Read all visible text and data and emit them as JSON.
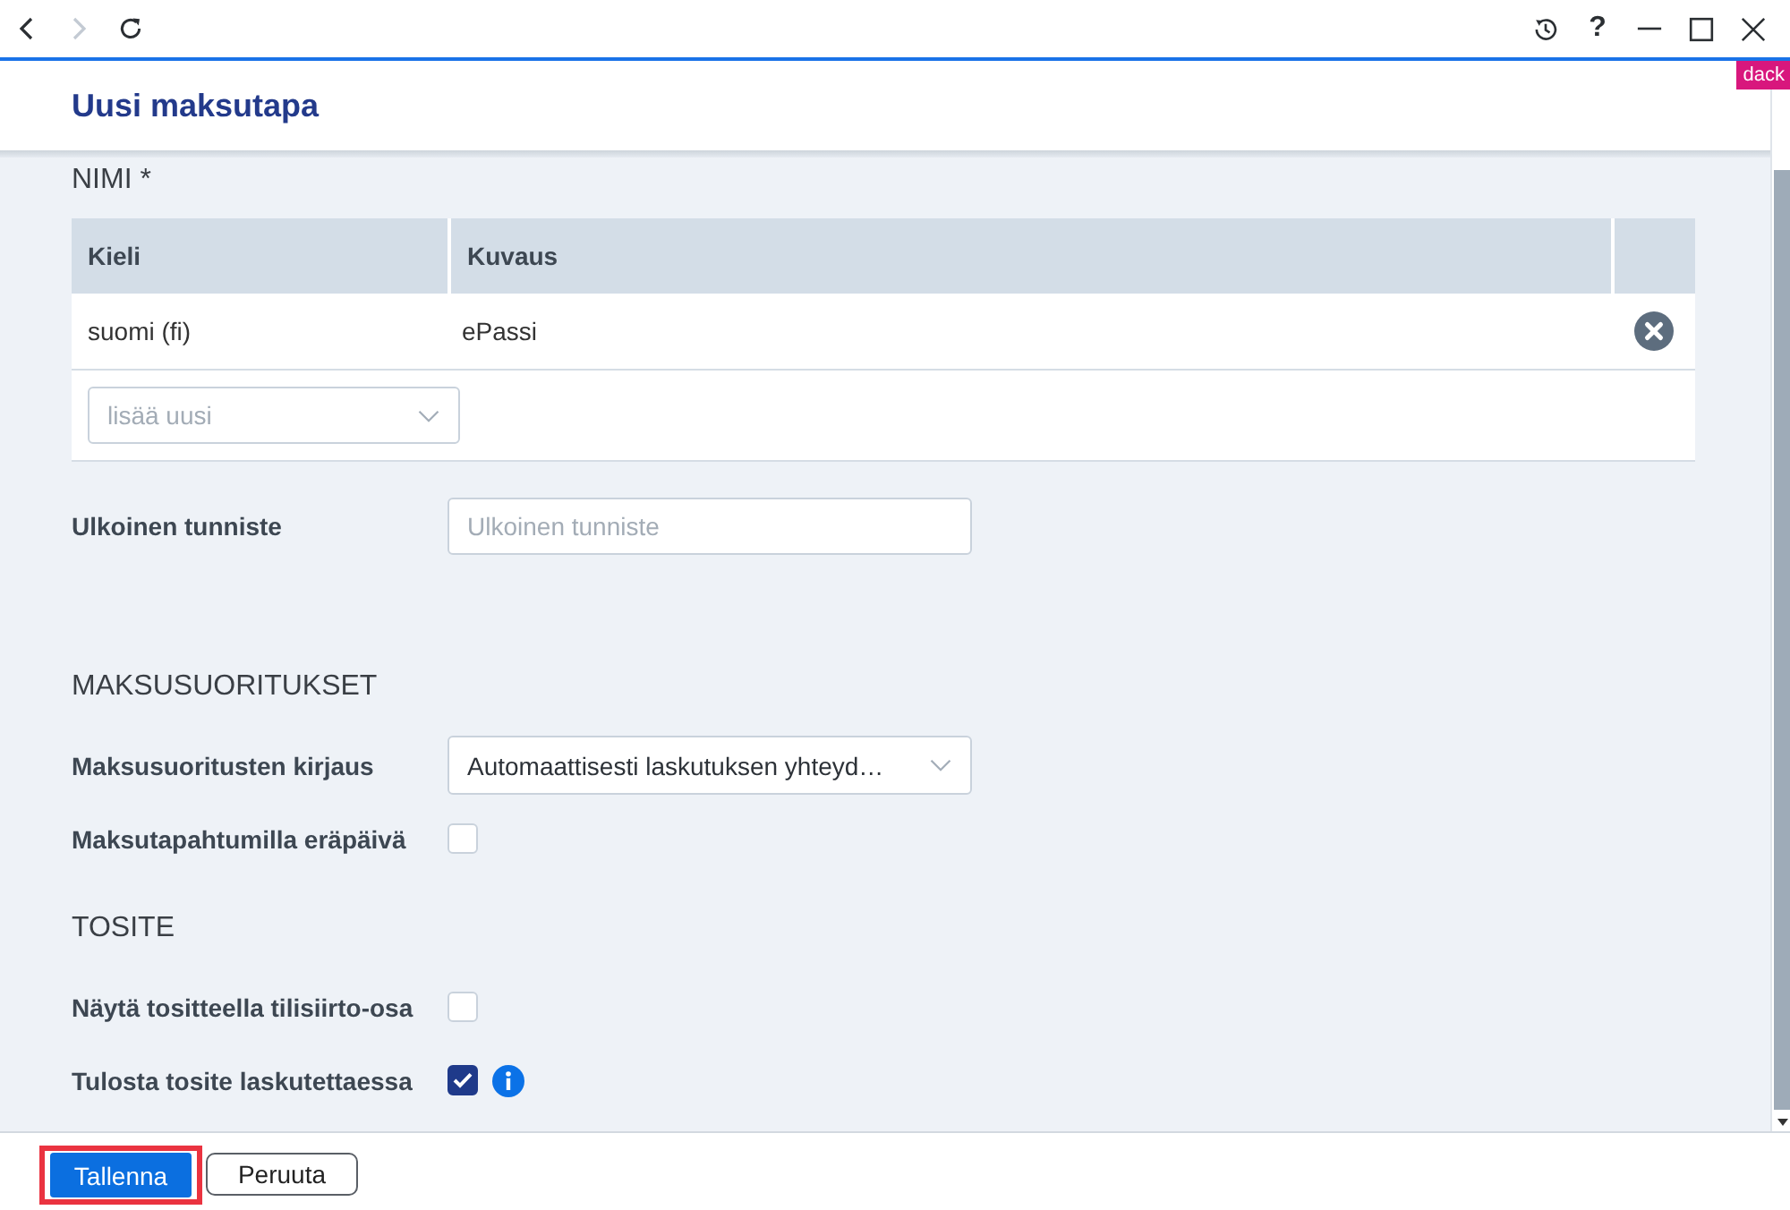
{
  "browser_bar": {
    "nav": [
      {
        "kind": "back",
        "disabled": false
      },
      {
        "kind": "forward",
        "disabled": true
      },
      {
        "kind": "reload",
        "disabled": false
      }
    ],
    "controls": [
      {
        "kind": "history"
      },
      {
        "kind": "help",
        "text": "?"
      },
      {
        "kind": "minimize"
      },
      {
        "kind": "maximize"
      },
      {
        "kind": "close"
      }
    ]
  },
  "badge": {
    "text": "dack"
  },
  "header": {
    "title": "Uusi maksutapa"
  },
  "name_section": {
    "heading": "NIMI *",
    "table": {
      "columns": [
        "Kieli",
        "Kuvaus"
      ],
      "rows": [
        {
          "language": "suomi (fi)",
          "description": "ePassi"
        }
      ],
      "add_select": {
        "placeholder": "lisää uusi"
      }
    }
  },
  "external_id": {
    "label": "Ulkoinen tunniste",
    "placeholder": "Ulkoinen tunniste"
  },
  "sections": [
    {
      "heading": "MAKSUSUORITUKSET",
      "fields": [
        {
          "kind": "select",
          "label": "Maksusuoritusten kirjaus",
          "value": "Automaattisesti laskutuksen yhteyd…",
          "info": false
        },
        {
          "kind": "checkbox",
          "label": "Maksutapahtumilla eräpäivä",
          "checked": false,
          "info": false
        }
      ]
    },
    {
      "heading": "TOSITE",
      "fields": [
        {
          "kind": "checkbox",
          "label": "Näytä tositteella tilisiirto-osa",
          "checked": false,
          "info": false
        },
        {
          "kind": "checkbox",
          "label": "Tulosta tosite laskutettaessa",
          "checked": true,
          "info": true
        }
      ]
    }
  ],
  "footer": {
    "buttons": [
      {
        "kind": "primary",
        "label": "Tallenna",
        "highlighted": true
      },
      {
        "kind": "secondary",
        "label": "Peruuta",
        "highlighted": false
      }
    ]
  }
}
